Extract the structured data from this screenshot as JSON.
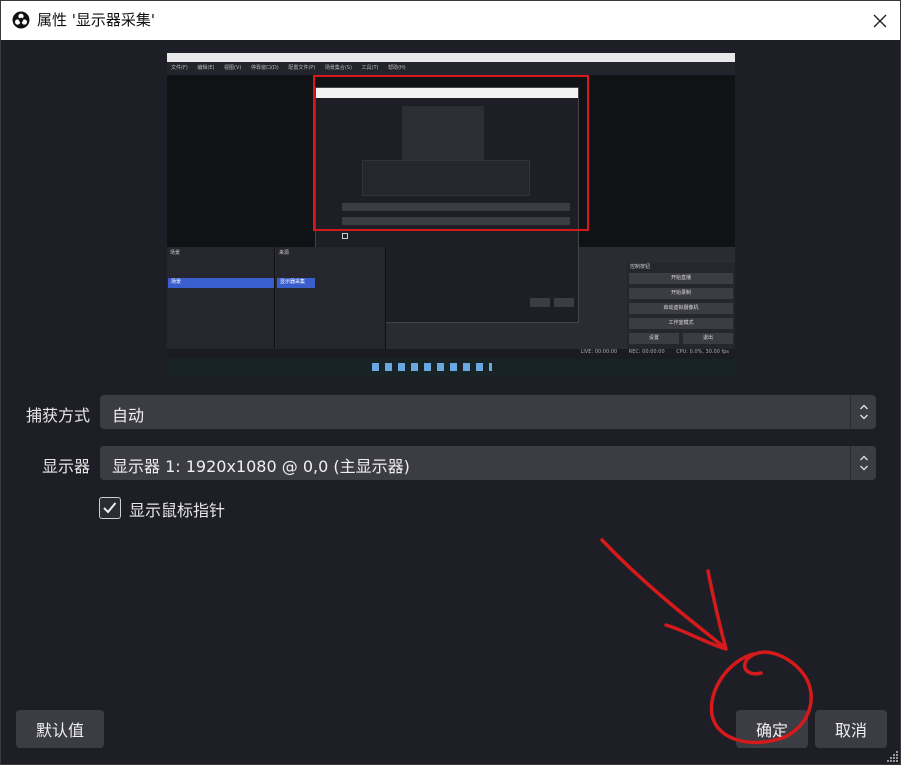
{
  "window": {
    "title": "属性 '显示器采集'"
  },
  "preview": {
    "menu_items": [
      "文件(F)",
      "编辑(E)",
      "视图(V)",
      "停靠窗口(D)",
      "配置文件(P)",
      "场景集合(S)",
      "工具(T)",
      "帮助(H)"
    ],
    "scenes_header": "场景",
    "scene_item": "场景",
    "sources_header": "来源",
    "source_item": "显示器采集",
    "controls_header": "控制按钮",
    "control_buttons": [
      "开始直播",
      "开始录制",
      "启动虚拟摄像机",
      "工作室模式",
      "设置",
      "退出"
    ],
    "status": [
      "LIVE: 00:00:00",
      "REC: 00:00:00",
      "CPU: 0.0%, 30.00 fps"
    ]
  },
  "form": {
    "capture_method": {
      "label": "捕获方式",
      "value": "自动"
    },
    "display": {
      "label": "显示器",
      "value": "显示器 1: 1920x1080 @ 0,0 (主显示器)"
    },
    "show_cursor": {
      "label": "显示鼠标指针",
      "checked": true
    }
  },
  "buttons": {
    "defaults": "默认值",
    "ok": "确定",
    "cancel": "取消"
  },
  "colors": {
    "background": "#1e1f26",
    "control": "#3b3c44",
    "annotation": "#d41a1a",
    "selection": "#3a5fcd"
  },
  "icons": {
    "app": "obs-icon",
    "close": "close-icon",
    "spin": "up-down-chevron-icon",
    "check": "check-icon"
  }
}
